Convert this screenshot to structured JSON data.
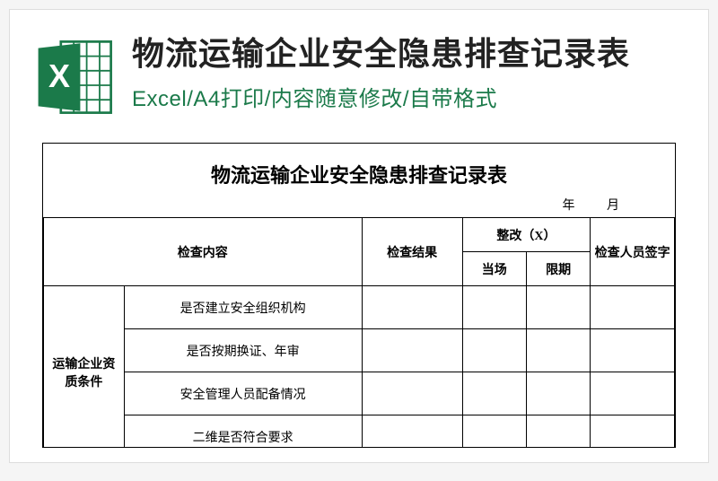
{
  "icon_label": "X",
  "main_title": "物流运输企业安全隐患排查记录表",
  "sub_title": "Excel/A4打印/内容随意修改/自带格式",
  "doc": {
    "title": "物流运输企业安全隐患排查记录表",
    "date_year_label": "年",
    "date_month_label": "月",
    "headers": {
      "content": "检查内容",
      "result": "检查结果",
      "fix_group": "整改（X）",
      "fix_now": "当场",
      "fix_deadline": "限期",
      "signature": "检查人员签字"
    },
    "category": "运输企业资质条件",
    "items": [
      "是否建立安全组织机构",
      "是否按期换证、年审",
      "安全管理人员配备情况",
      "二维是否符合要求"
    ]
  }
}
